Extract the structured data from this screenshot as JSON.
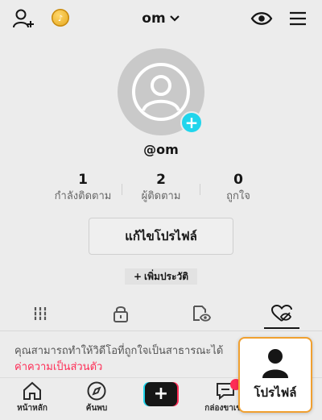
{
  "header": {
    "username": "om"
  },
  "profile": {
    "handle": "@om"
  },
  "stats": [
    {
      "count": "1",
      "label": "กำลังติดตาม"
    },
    {
      "count": "2",
      "label": "ผู้ติดตาม"
    },
    {
      "count": "0",
      "label": "ถูกใจ"
    }
  ],
  "actions": {
    "edit_profile": "แก้ไขโปรไฟล์",
    "add_bio_plus": "+",
    "add_bio": "เพิ่มประวัติ"
  },
  "tabs": [
    {
      "icon": "grid-icon"
    },
    {
      "icon": "lock-icon"
    },
    {
      "icon": "repost-eye-icon"
    },
    {
      "icon": "liked-hidden-icon",
      "active": true
    }
  ],
  "notice": {
    "text": "คุณสามารถทำให้วิดีโอที่ถูกใจเป็นสาธารณะได้",
    "link": "ค่าความเป็นส่วนตัว"
  },
  "bottom_nav": {
    "home": "หน้าหลัก",
    "discover": "ค้นพบ",
    "create": "+",
    "inbox": "กล่องขาเข้า",
    "profile": "โปรไฟล์"
  },
  "colors": {
    "accent_red": "#fe2c55",
    "accent_cyan": "#20d5ec",
    "highlight_border": "#f0a030"
  }
}
